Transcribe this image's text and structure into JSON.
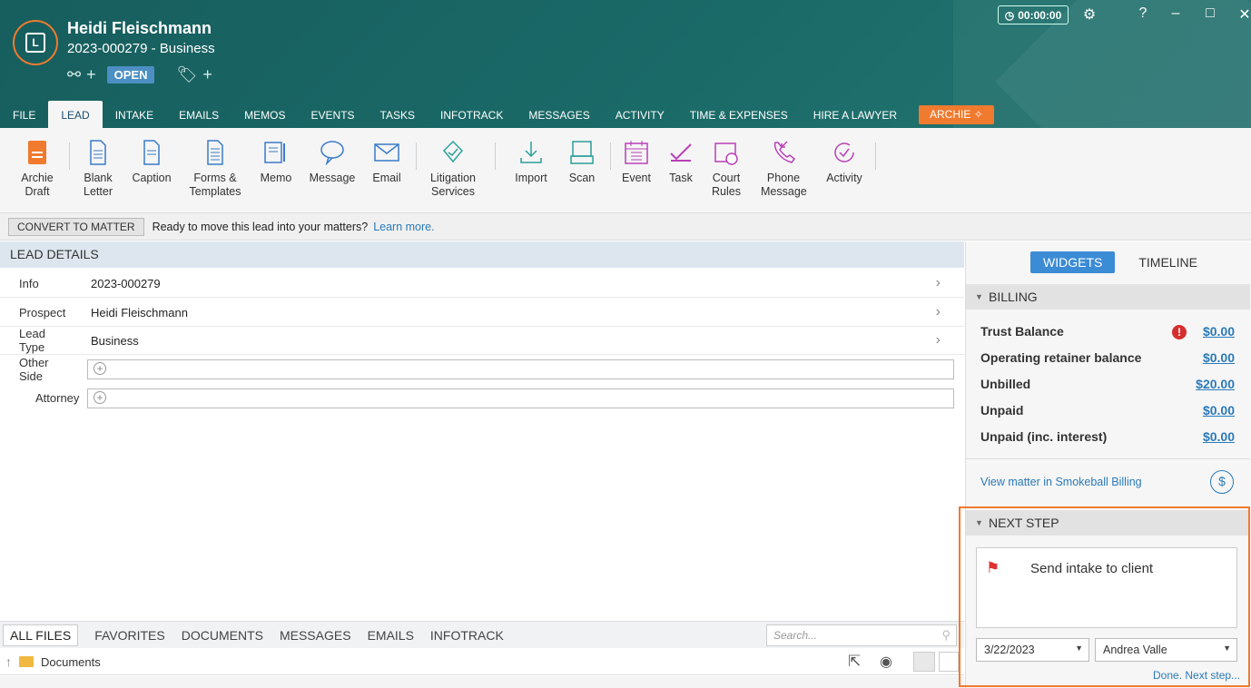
{
  "header": {
    "client_name": "Heidi Fleischmann",
    "matter_line": "2023-000279  - Business",
    "status": "OPEN",
    "timer": "00:00:00"
  },
  "tabs": [
    "FILE",
    "LEAD",
    "INTAKE",
    "EMAILS",
    "MEMOS",
    "EVENTS",
    "TASKS",
    "INFOTRACK",
    "MESSAGES",
    "ACTIVITY",
    "TIME & EXPENSES",
    "HIRE A LAWYER"
  ],
  "archie_tab": "ARCHIE",
  "ribbon": {
    "archie_draft": "Archie Draft",
    "blank_letter": "Blank Letter",
    "caption": "Caption",
    "forms_templates": "Forms & Templates",
    "memo": "Memo",
    "message": "Message",
    "email": "Email",
    "litigation_services": "Litigation Services",
    "import": "Import",
    "scan": "Scan",
    "event": "Event",
    "task": "Task",
    "court_rules": "Court Rules",
    "phone_message": "Phone Message",
    "activity": "Activity"
  },
  "convert_bar": {
    "button": "CONVERT TO MATTER",
    "text": "Ready to move this lead into your matters?",
    "link": "Learn more."
  },
  "lead_details": {
    "title": "LEAD DETAILS",
    "info_label": "Info",
    "info_value": "2023-000279",
    "prospect_label": "Prospect",
    "prospect_value": "Heidi Fleischmann",
    "lead_type_label": "Lead Type",
    "lead_type_value": "Business",
    "other_side_label": "Other Side",
    "attorney_label": "Attorney"
  },
  "file_tabs": [
    "ALL FILES",
    "FAVORITES",
    "DOCUMENTS",
    "MESSAGES",
    "EMAILS",
    "INFOTRACK"
  ],
  "search_placeholder": "Search...",
  "folder_name": "Documents",
  "right_panel": {
    "widgets_tab": "WIDGETS",
    "timeline_tab": "TIMELINE",
    "billing_title": "BILLING",
    "billing_rows": [
      {
        "label": "Trust Balance",
        "amount": "$0.00"
      },
      {
        "label": "Operating retainer balance",
        "amount": "$0.00"
      },
      {
        "label": "Unbilled",
        "amount": "$20.00"
      },
      {
        "label": "Unpaid",
        "amount": "$0.00"
      },
      {
        "label": "Unpaid (inc. interest)",
        "amount": "$0.00"
      }
    ],
    "view_billing": "View matter in Smokeball Billing",
    "next_step_title": "NEXT STEP",
    "task_text": "Send intake to client",
    "date": "3/22/2023",
    "assignee": "Andrea Valle",
    "done_link": "Done. Next step..."
  },
  "colors": {
    "header_teal": "#175e5e",
    "accent_orange": "#f07a2e",
    "link_blue": "#2a7ab9",
    "status_blue": "#4c8fc4"
  }
}
